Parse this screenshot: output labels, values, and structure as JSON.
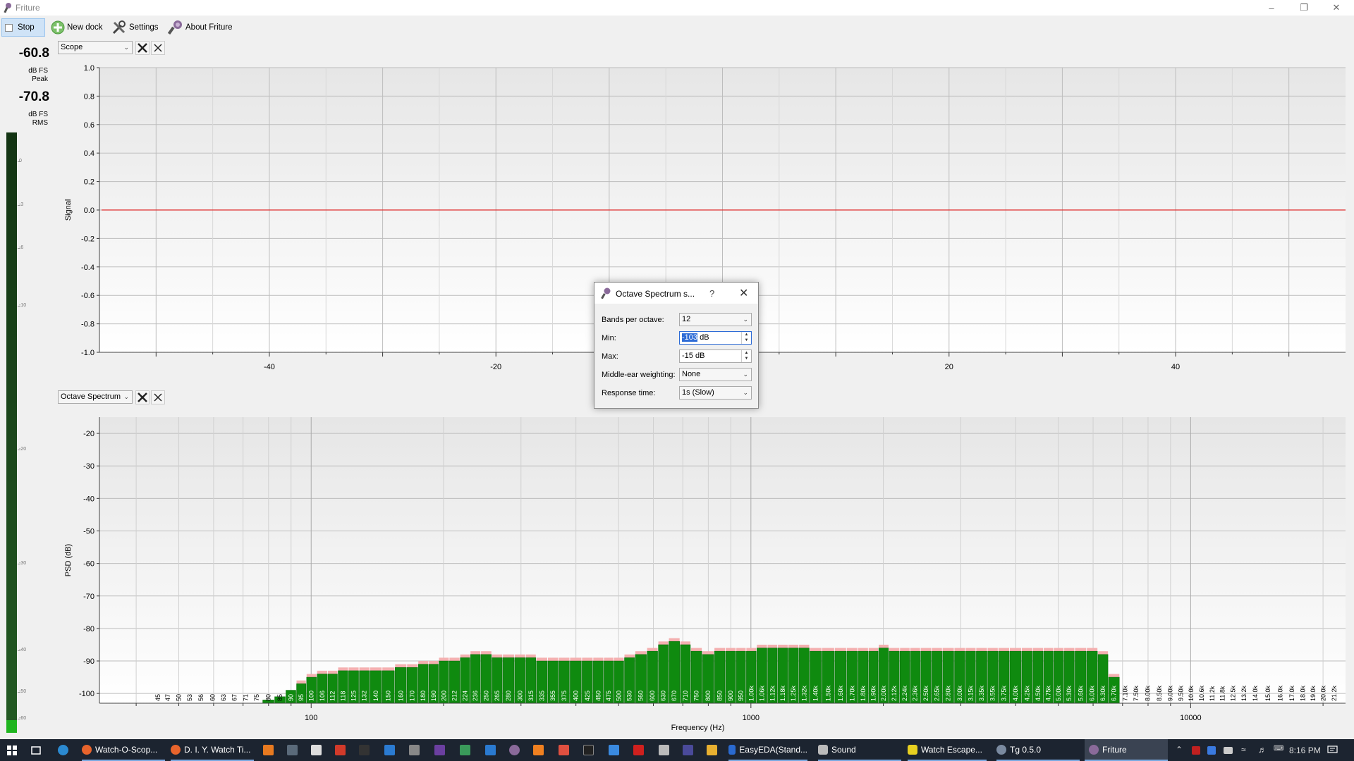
{
  "window": {
    "title": "Friture",
    "controls": [
      "minimize",
      "restore",
      "close"
    ]
  },
  "toolbar": {
    "stop_label": "Stop",
    "new_dock_label": "New dock",
    "settings_label": "Settings",
    "about_label": "About Friture"
  },
  "levels": {
    "peak_value": "-60.8",
    "peak_unit": "dB FS",
    "peak_label": "Peak",
    "rms_value": "-70.8",
    "rms_unit": "dB FS",
    "rms_label": "RMS",
    "scale_ticks": [
      "0",
      "-3",
      "-6",
      "-10",
      "-20",
      "-30",
      "-40",
      "-50",
      "-60"
    ]
  },
  "scope_dock": {
    "selector": "Scope",
    "y_label": "Signal",
    "y_ticks": [
      "1.0",
      "0.8",
      "0.6",
      "0.4",
      "0.2",
      "0.0",
      "-0.2",
      "-0.4",
      "-0.6",
      "-0.8",
      "-1.0"
    ],
    "x_ticks": [
      "-40",
      "-20",
      "20",
      "40"
    ],
    "trace_color": "#e03030"
  },
  "spectrum_dock": {
    "selector": "Octave Spectrum",
    "y_label": "PSD (dB)",
    "x_label": "Frequency (Hz)",
    "x_major_ticks": [
      "100",
      "1000",
      "10000"
    ],
    "bar_color": "#0f8a0f",
    "peak_color": "#f4b0b0"
  },
  "chart_data": {
    "type": "bar",
    "x_scale": "log",
    "ylim": [
      -103,
      -15
    ],
    "y_ticks": [
      -20,
      -30,
      -40,
      -50,
      -60,
      -70,
      -80,
      -90,
      -100
    ],
    "xlabel": "Frequency (Hz)",
    "ylabel": "PSD (dB)",
    "categories": [
      "45",
      "47",
      "50",
      "53",
      "56",
      "60",
      "63",
      "67",
      "71",
      "75",
      "80",
      "85",
      "90",
      "95",
      "100",
      "106",
      "112",
      "118",
      "125",
      "132",
      "140",
      "150",
      "160",
      "170",
      "180",
      "190",
      "200",
      "212",
      "224",
      "236",
      "250",
      "265",
      "280",
      "300",
      "315",
      "335",
      "355",
      "375",
      "400",
      "425",
      "450",
      "475",
      "500",
      "530",
      "560",
      "600",
      "630",
      "670",
      "710",
      "750",
      "800",
      "850",
      "900",
      "950",
      "1.00k",
      "1.06k",
      "1.12k",
      "1.18k",
      "1.25k",
      "1.32k",
      "1.40k",
      "1.50k",
      "1.60k",
      "1.70k",
      "1.80k",
      "1.90k",
      "2.00k",
      "2.12k",
      "2.24k",
      "2.36k",
      "2.50k",
      "2.65k",
      "2.80k",
      "3.00k",
      "3.15k",
      "3.35k",
      "3.55k",
      "3.75k",
      "4.00k",
      "4.25k",
      "4.50k",
      "4.75k",
      "5.00k",
      "5.30k",
      "5.60k",
      "6.00k",
      "6.30k",
      "6.70k",
      "7.10k",
      "7.50k",
      "8.00k",
      "8.50k",
      "9.00k",
      "9.50k",
      "10.0k",
      "10.6k",
      "11.2k",
      "11.8k",
      "12.5k",
      "13.2k",
      "14.0k",
      "15.0k",
      "16.0k",
      "17.0k",
      "18.0k",
      "19.0k",
      "20.0k",
      "21.2k"
    ],
    "freqs": [
      45,
      47,
      50,
      53,
      56,
      60,
      63,
      67,
      71,
      75,
      80,
      85,
      90,
      95,
      100,
      106,
      112,
      118,
      125,
      132,
      140,
      150,
      160,
      170,
      180,
      190,
      200,
      212,
      224,
      236,
      250,
      265,
      280,
      300,
      315,
      335,
      355,
      375,
      400,
      425,
      450,
      475,
      500,
      530,
      560,
      600,
      630,
      670,
      710,
      750,
      800,
      850,
      900,
      950,
      1000,
      1060,
      1120,
      1180,
      1250,
      1320,
      1400,
      1500,
      1600,
      1700,
      1800,
      1900,
      2000,
      2120,
      2240,
      2360,
      2500,
      2650,
      2800,
      3000,
      3150,
      3350,
      3550,
      3750,
      4000,
      4250,
      4500,
      4750,
      5000,
      5300,
      5600,
      6000,
      6300,
      6700,
      7100,
      7500,
      8000,
      8500,
      9000,
      9500,
      10000,
      10600,
      11200,
      11800,
      12500,
      13200,
      14000,
      15000,
      16000,
      17000,
      18000,
      19000,
      20000,
      21200
    ],
    "values": [
      -103,
      -103,
      -103,
      -103,
      -103,
      -103,
      -103,
      -103,
      -103,
      -103,
      -102,
      -101,
      -99,
      -97,
      -95,
      -94,
      -94,
      -93,
      -93,
      -93,
      -93,
      -93,
      -92,
      -92,
      -91,
      -91,
      -90,
      -90,
      -89,
      -88,
      -88,
      -89,
      -89,
      -89,
      -89,
      -90,
      -90,
      -90,
      -90,
      -90,
      -90,
      -90,
      -90,
      -89,
      -88,
      -87,
      -85,
      -84,
      -85,
      -87,
      -88,
      -87,
      -87,
      -87,
      -87,
      -86,
      -86,
      -86,
      -86,
      -86,
      -87,
      -87,
      -87,
      -87,
      -87,
      -87,
      -86,
      -87,
      -87,
      -87,
      -87,
      -87,
      -87,
      -87,
      -87,
      -87,
      -87,
      -87,
      -87,
      -87,
      -87,
      -87,
      -87,
      -87,
      -87,
      -87,
      -88,
      -95,
      -103,
      -103,
      -103,
      -103,
      -103,
      -103,
      -103,
      -103,
      -103,
      -103,
      -103,
      -103,
      -103,
      -103,
      -103,
      -103,
      -103,
      -103,
      -103,
      -103
    ],
    "peaks": [
      -103,
      -103,
      -103,
      -103,
      -103,
      -103,
      -103,
      -103,
      -103,
      -103,
      -102,
      -101,
      -99,
      -96,
      -94,
      -93,
      -93,
      -92,
      -92,
      -92,
      -92,
      -92,
      -91,
      -91,
      -90,
      -90,
      -89,
      -89,
      -88,
      -87,
      -87,
      -88,
      -88,
      -88,
      -88,
      -89,
      -89,
      -89,
      -89,
      -89,
      -89,
      -89,
      -89,
      -88,
      -87,
      -86,
      -84,
      -83,
      -84,
      -86,
      -87,
      -86,
      -86,
      -86,
      -86,
      -85,
      -85,
      -85,
      -85,
      -85,
      -86,
      -86,
      -86,
      -86,
      -86,
      -86,
      -85,
      -86,
      -86,
      -86,
      -86,
      -86,
      -86,
      -86,
      -86,
      -86,
      -86,
      -86,
      -86,
      -86,
      -86,
      -86,
      -86,
      -86,
      -86,
      -86,
      -87,
      -94,
      -103,
      -103,
      -103,
      -103,
      -103,
      -103,
      -103,
      -103,
      -103,
      -103,
      -103,
      -103,
      -103,
      -103,
      -103,
      -103,
      -103,
      -103,
      -103,
      -103
    ]
  },
  "dialog": {
    "title": "Octave Spectrum s...",
    "help": "?",
    "rows": [
      {
        "label": "Bands per octave:",
        "value": "12"
      },
      {
        "label": "Min:",
        "value": "-103 dB"
      },
      {
        "label": "Max:",
        "value": "-15 dB"
      },
      {
        "label": "Middle-ear weighting:",
        "value": "None"
      },
      {
        "label": "Response time:",
        "value": "1s (Slow)"
      }
    ],
    "min_selected": "-103",
    "min_unit": " dB"
  },
  "taskbar": {
    "apps": [
      {
        "label": "Watch-O-Scop..."
      },
      {
        "label": "D. I. Y. Watch Ti..."
      },
      {
        "label": "EasyEDA(Stand..."
      },
      {
        "label": "Sound"
      },
      {
        "label": "Watch Escape..."
      },
      {
        "label": "Tg 0.5.0"
      },
      {
        "label": "Friture"
      }
    ],
    "time": "8:16 PM"
  }
}
